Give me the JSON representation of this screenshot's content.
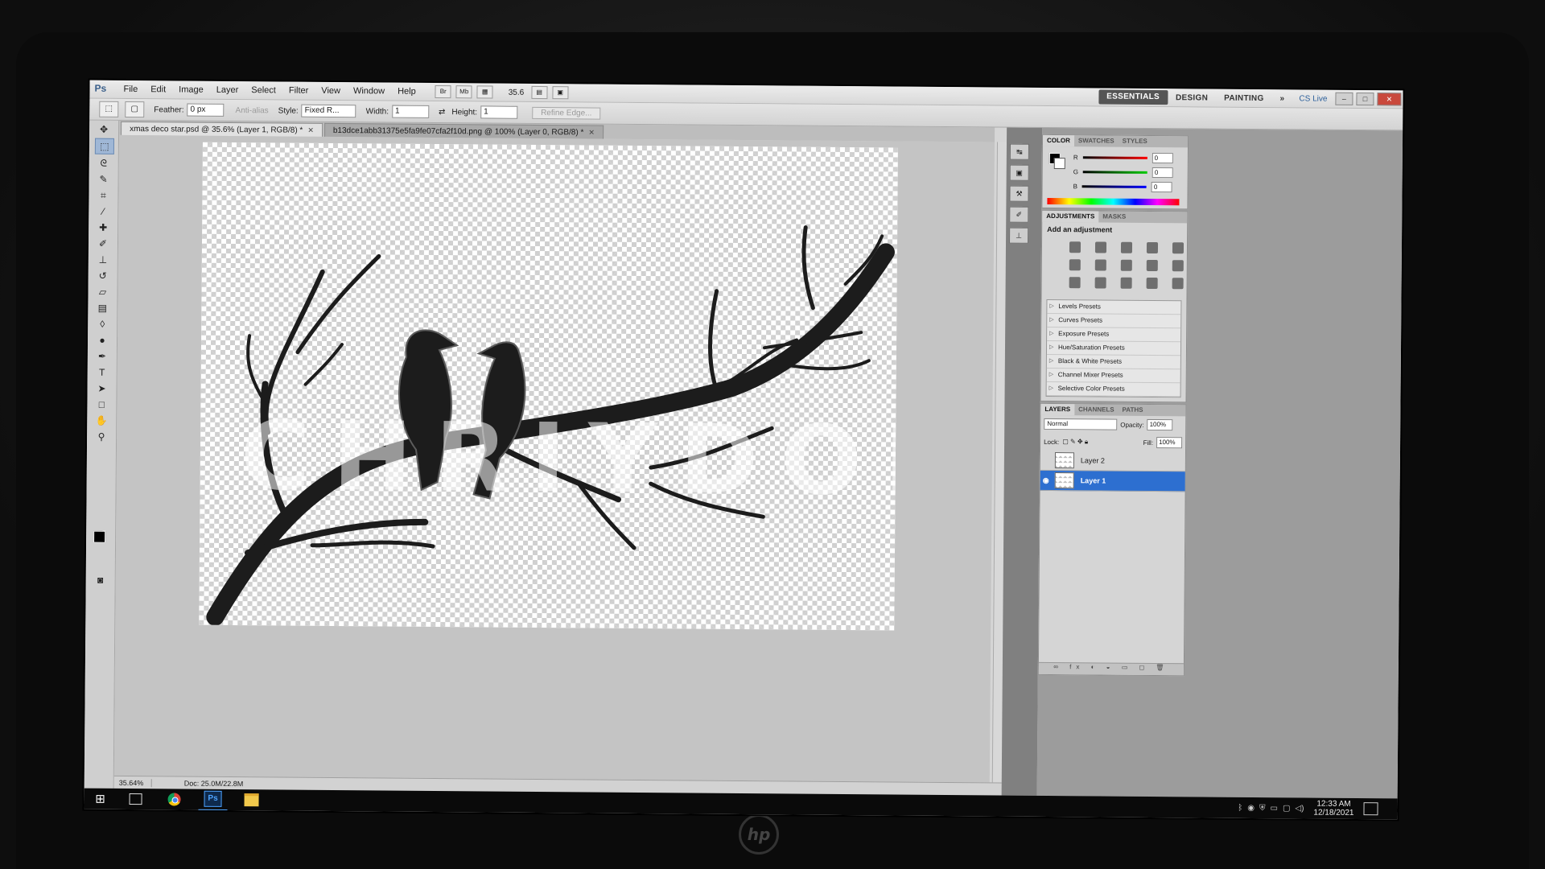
{
  "menu": {
    "logo": "Ps",
    "items": [
      "File",
      "Edit",
      "Image",
      "Layer",
      "Select",
      "Filter",
      "View",
      "Window",
      "Help"
    ],
    "mini_buttons": [
      "Br",
      "Mb"
    ],
    "zoom": "35.6",
    "workspaces": [
      "ESSENTIALS",
      "DESIGN",
      "PAINTING"
    ],
    "more": "»",
    "cslive": "CS Live",
    "win_controls": [
      "–",
      "□",
      "✕"
    ]
  },
  "options": {
    "feather_label": "Feather:",
    "feather_value": "0 px",
    "antialias": "Anti-alias",
    "style_label": "Style:",
    "style_value": "Fixed R...",
    "width_label": "Width:",
    "width_value": "1",
    "swap": "⇄",
    "height_label": "Height:",
    "height_value": "1",
    "refine": "Refine Edge..."
  },
  "tabs": [
    {
      "label": "xmas deco star.psd @ 35.6% (Layer 1, RGB/8) *",
      "close": "✕"
    },
    {
      "label": "b13dce1abb31375e5fa9fe07cfa2f10d.png @ 100% (Layer 0, RGB/8) *",
      "close": "✕"
    }
  ],
  "canvas": {
    "watermark": "CHRIYDON",
    "colors": {
      "silhouette": "#1c1c1c",
      "highlight": "#5c5c5c"
    }
  },
  "status": {
    "zoom": "35.64%",
    "doc": "Doc: 25.0M/22.8M"
  },
  "color_panel": {
    "tabs": [
      "COLOR",
      "SWATCHES",
      "STYLES"
    ],
    "channels": [
      {
        "name": "R",
        "value": "0",
        "color": "#d22"
      },
      {
        "name": "G",
        "value": "0",
        "color": "#2a2"
      },
      {
        "name": "B",
        "value": "0",
        "color": "#22d"
      }
    ]
  },
  "adjustments": {
    "tabs": [
      "ADJUSTMENTS",
      "MASKS"
    ],
    "title": "Add an adjustment",
    "presets": [
      "Levels Presets",
      "Curves Presets",
      "Exposure Presets",
      "Hue/Saturation Presets",
      "Black & White Presets",
      "Channel Mixer Presets",
      "Selective Color Presets"
    ]
  },
  "layers": {
    "tabs": [
      "LAYERS",
      "CHANNELS",
      "PATHS"
    ],
    "blend_mode": "Normal",
    "opacity_label": "Opacity:",
    "opacity": "100%",
    "lock_label": "Lock:",
    "fill_label": "Fill:",
    "fill": "100%",
    "items": [
      {
        "name": "Layer 2",
        "selected": false
      },
      {
        "name": "Layer 1",
        "selected": true
      }
    ]
  },
  "taskbar": {
    "time": "12:33 AM",
    "date": "12/18/2021",
    "ps_label": "Ps",
    "start": "⊞"
  },
  "brand": "hp"
}
